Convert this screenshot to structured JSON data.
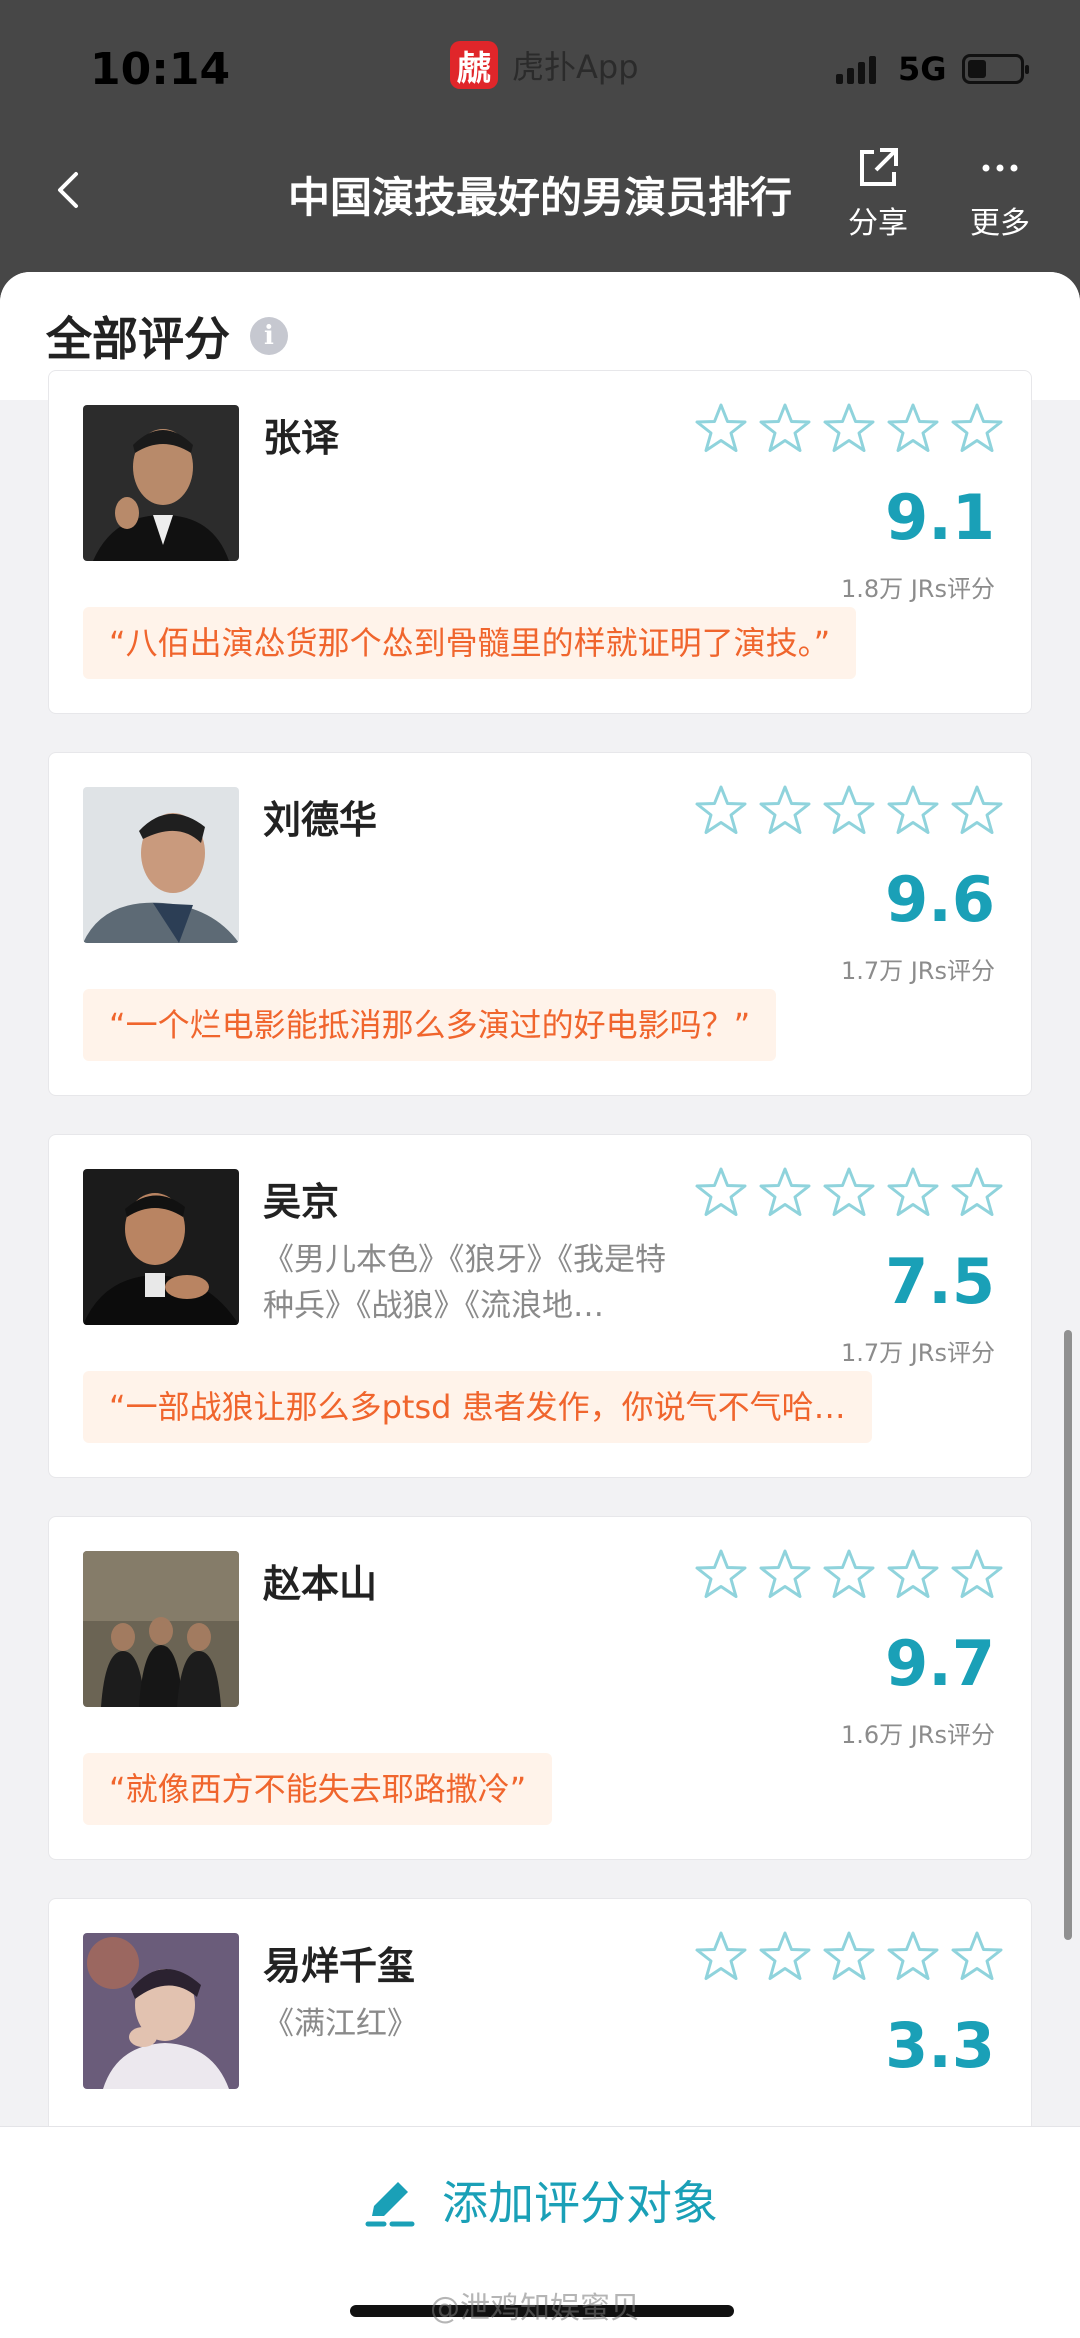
{
  "status_bar": {
    "time": "10:14",
    "app_name": "虎扑App",
    "app_logo_text": "虤",
    "network": "5G",
    "battery_level": 0.35
  },
  "nav": {
    "title": "中国演技最好的男演员排行",
    "share_label": "分享",
    "more_label": "更多"
  },
  "section": {
    "title": "全部评分",
    "info_icon": "i"
  },
  "colors": {
    "accent": "#1aa0b7",
    "quote_text": "#f0652d",
    "quote_bg": "#fff3ea",
    "header_bg": "#474747"
  },
  "cards": [
    {
      "name": "张译",
      "works": "",
      "stars_filled": 0,
      "score": "9.1",
      "count": "1.8万 JRs评分",
      "quote": "“八佰出演怂货那个怂到骨髓里的样就证明了演技。”"
    },
    {
      "name": "刘德华",
      "works": "",
      "stars_filled": 0,
      "score": "9.6",
      "count": "1.7万 JRs评分",
      "quote": "“一个烂电影能抵消那么多演过的好电影吗？”"
    },
    {
      "name": "吴京",
      "works": "《男儿本色》《狼牙》《我是特种兵》《战狼》《流浪地…",
      "stars_filled": 0,
      "score": "7.5",
      "count": "1.7万 JRs评分",
      "quote": "“一部战狼让那么多ptsd 患者发作，你说气不气哈…"
    },
    {
      "name": "赵本山",
      "works": "",
      "stars_filled": 0,
      "score": "9.7",
      "count": "1.6万 JRs评分",
      "quote": "“就像西方不能失去耶路撒冷”"
    },
    {
      "name": "易烊千玺",
      "works": "《满江红》",
      "stars_filled": 0,
      "score": "3.3",
      "count": "",
      "quote": ""
    }
  ],
  "bottom": {
    "add_label": "添加评分对象",
    "watermark": "@泄鸡知娱蜜贝"
  }
}
